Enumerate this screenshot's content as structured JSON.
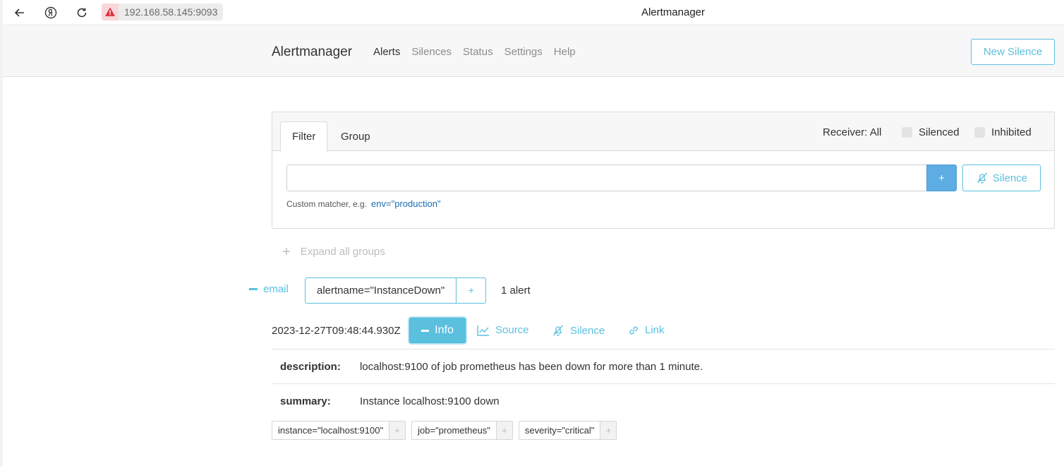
{
  "browser": {
    "url": "192.168.58.145:9093",
    "tab_title": "Alertmanager"
  },
  "navbar": {
    "brand": "Alertmanager",
    "links": [
      "Alerts",
      "Silences",
      "Status",
      "Settings",
      "Help"
    ],
    "active_link": "Alerts",
    "new_silence": "New Silence"
  },
  "filter": {
    "tabs": [
      "Filter",
      "Group"
    ],
    "receiver": "Receiver: All",
    "silenced": "Silenced",
    "inhibited": "Inhibited",
    "input_value": "",
    "plus": "+",
    "silence_btn": "Silence",
    "hint": "Custom matcher, e.g.",
    "hint_example": "env=\"production\""
  },
  "expand_all": "Expand all groups",
  "group": {
    "receiver": "email",
    "label": "alertname=\"InstanceDown\"",
    "label_plus": "+",
    "count": "1 alert"
  },
  "alert": {
    "timestamp": "2023-12-27T09:48:44.930Z",
    "info": "Info",
    "source": "Source",
    "silence": "Silence",
    "link": "Link",
    "annotations": [
      {
        "key": "description:",
        "value": "localhost:9100 of job prometheus has been down for more than 1 minute."
      },
      {
        "key": "summary:",
        "value": "Instance localhost:9100 down"
      }
    ],
    "labels": [
      "instance=\"localhost:9100\"",
      "job=\"prometheus\"",
      "severity=\"critical\""
    ],
    "label_plus": "+"
  },
  "colors": {
    "accent": "#5bc0de",
    "primary": "#5dade2",
    "warning": "#dc3545"
  }
}
